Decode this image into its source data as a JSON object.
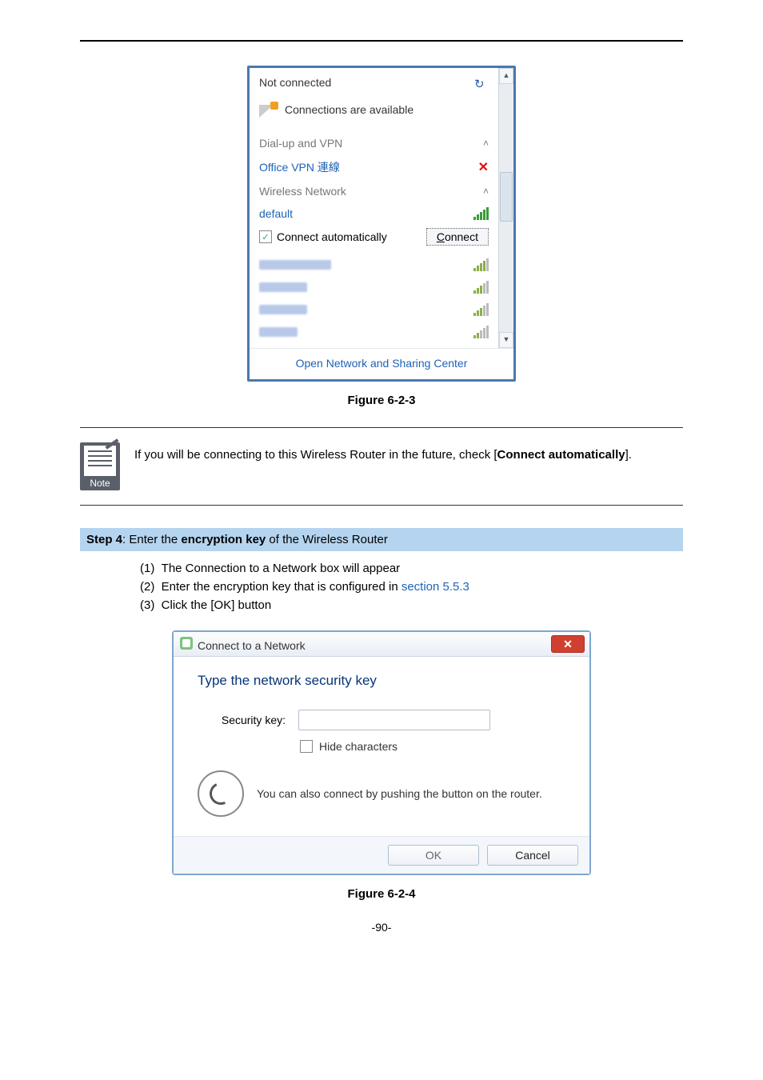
{
  "flyout": {
    "status": "Not connected",
    "available": "Connections are available",
    "sections": {
      "dialup": {
        "label": "Dial-up and VPN",
        "item": "Office VPN 連線"
      },
      "wireless": {
        "label": "Wireless Network",
        "selected": {
          "name": "default",
          "auto_label": "Connect automatically",
          "auto_checked": true,
          "button": "Connect"
        },
        "other_signal_levels": [
          4,
          3,
          3,
          2
        ]
      }
    },
    "footer": "Open Network and Sharing Center"
  },
  "fig1_caption": "Figure 6-2-3",
  "note": {
    "label": "Note",
    "text_pre": "If you will be connecting to this Wireless Router in the future, check [",
    "text_bold": "Connect automatically",
    "text_post": "]."
  },
  "step": {
    "bar_pre": "Step 4",
    "bar_mid": ": Enter the ",
    "bar_bold": "encryption key",
    "bar_post": " of the Wireless Router",
    "items": {
      "a": "The Connection to a Network box will appear",
      "b_pre": "Enter the encryption key that is configured in ",
      "b_link": "section 5.5.3",
      "c": "Click the [OK] button"
    }
  },
  "dialog": {
    "title": "Connect to a Network",
    "heading": "Type the network security key",
    "key_label": "Security key:",
    "key_value": "",
    "hide_label": "Hide characters",
    "hide_checked": false,
    "router_hint": "You can also connect by pushing the button on the router.",
    "ok": "OK",
    "cancel": "Cancel"
  },
  "fig2_caption": "Figure 6-2-4",
  "page_number": "-90-"
}
